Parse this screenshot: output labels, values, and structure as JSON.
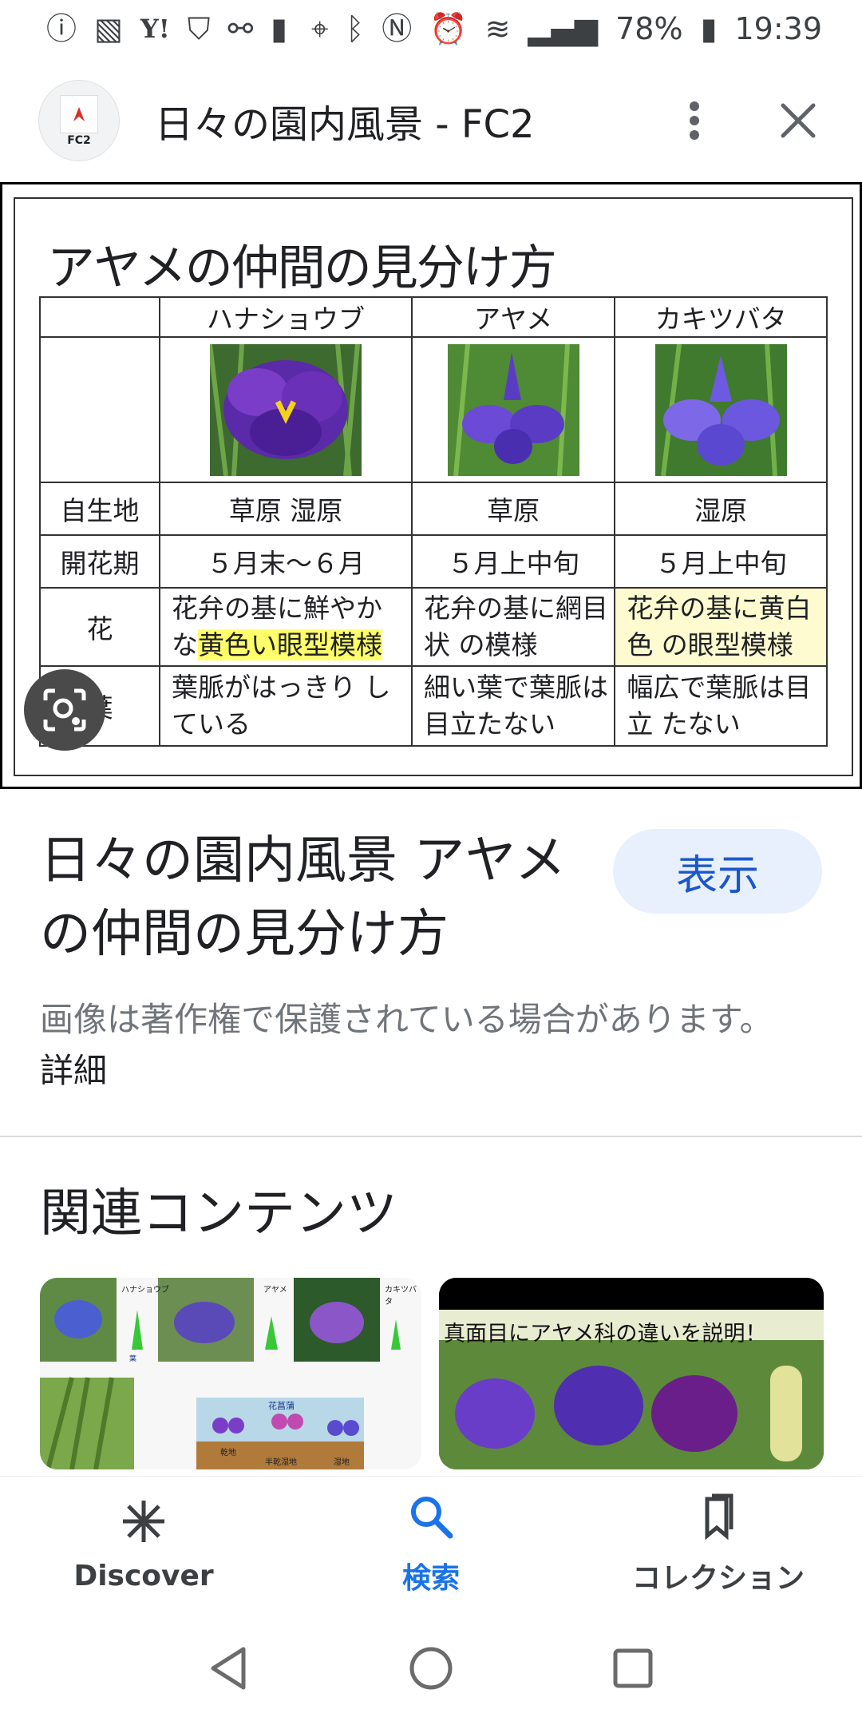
{
  "status_bar": {
    "battery": "78%",
    "time": "19:39",
    "icons_left": [
      "info-icon",
      "app-icon",
      "yahoo-icon",
      "shield-icon",
      "link-icon",
      "battery-plus-icon"
    ],
    "icons_right": [
      "location-icon",
      "bluetooth-icon",
      "nfc-icon",
      "alarm-icon",
      "wifi-icon",
      "signal-icon",
      "battery-icon"
    ]
  },
  "header": {
    "logo_text": "FC2",
    "title": "日々の園内風景 - FC2"
  },
  "image": {
    "heading": "アヤメの仲間の見分け方",
    "columns": [
      "ハナショウブ",
      "アヤメ",
      "カキツバタ"
    ],
    "rows": [
      {
        "label": "自生地",
        "cells": [
          "草原 湿原",
          "草原",
          "湿原"
        ]
      },
      {
        "label": "開花期",
        "cells": [
          "５月末～６月",
          "５月上中旬",
          "５月上中旬"
        ]
      },
      {
        "label": "花",
        "cells": [
          {
            "plain": "花弁の基に鮮やか な",
            "highlight": "黄色い眼型模様"
          },
          {
            "plain": "花弁の基に網目状 の模様",
            "highlight": ""
          },
          {
            "plain": "花弁の基に黄白色 の眼型模様",
            "highlight": ""
          }
        ]
      },
      {
        "label": "葉",
        "cells": [
          "葉脈がはっきり している",
          "細い葉で葉脈は 目立たない",
          "幅広で葉脈は目立 たない"
        ]
      }
    ]
  },
  "result": {
    "title": "日々の園内風景 アヤメの仲間の見分け方",
    "view_button": "表示",
    "copyright": "画像は著作権で保護されている場合があります。",
    "more_link": "詳細"
  },
  "related": {
    "heading": "関連コンテンツ",
    "card1_labels": [
      "ハナショウブ",
      "アヤメ",
      "カキツバタ",
      "葉",
      "花菖蒲",
      "乾地",
      "半乾湿地",
      "湿地"
    ],
    "card2_caption": "真面目にアヤメ科の違いを説明！"
  },
  "bottom_nav": [
    {
      "label": "Discover",
      "icon": "asterisk-icon",
      "active": false
    },
    {
      "label": "検索",
      "icon": "search-icon",
      "active": true
    },
    {
      "label": "コレクション",
      "icon": "bookmark-icon",
      "active": false
    }
  ],
  "colors": {
    "accent": "#1a73e8",
    "view_button_bg": "#e8f0fe",
    "highlight_yellow": "#ffff6a",
    "flower_purple": "#5b2aa8"
  }
}
